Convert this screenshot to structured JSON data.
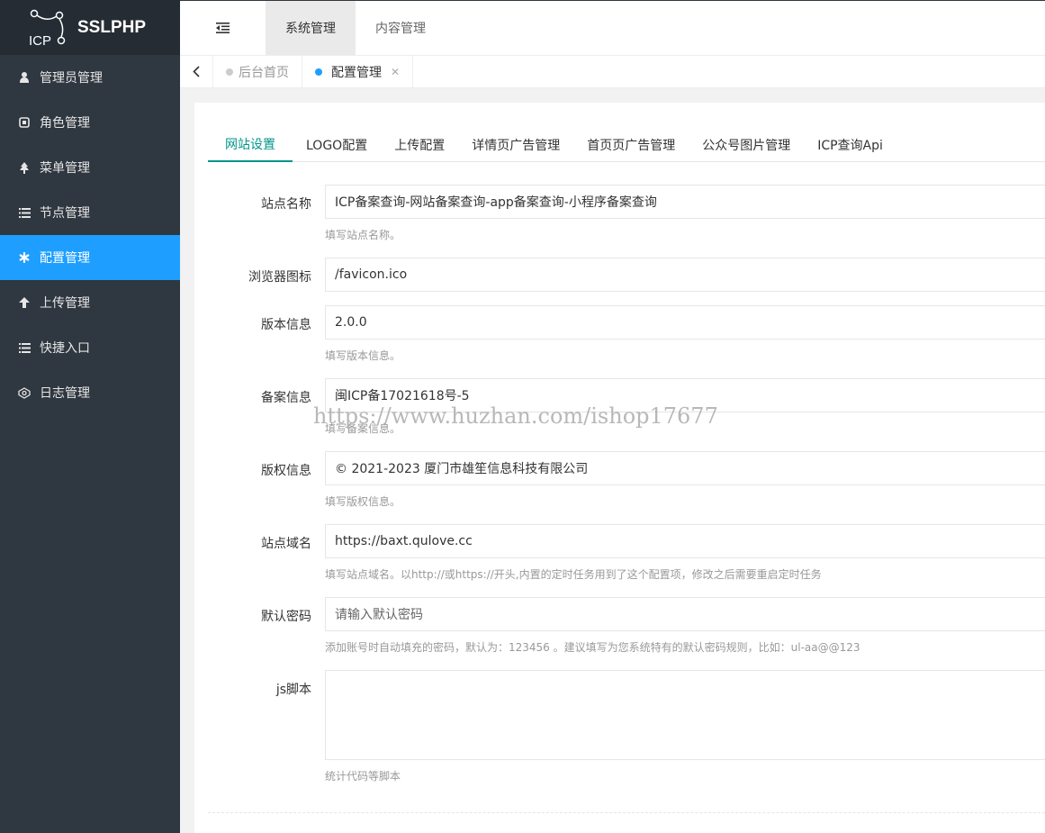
{
  "app": {
    "logo_mark": "ICP",
    "logo_text": "SSLPHP"
  },
  "sidebar": {
    "items": [
      {
        "label": "管理员管理",
        "icon": "user-icon"
      },
      {
        "label": "角色管理",
        "icon": "role-icon"
      },
      {
        "label": "菜单管理",
        "icon": "tree-icon"
      },
      {
        "label": "节点管理",
        "icon": "list-icon"
      },
      {
        "label": "配置管理",
        "icon": "gear-icon",
        "active": true
      },
      {
        "label": "上传管理",
        "icon": "arrow-up-icon"
      },
      {
        "label": "快捷入口",
        "icon": "list-icon"
      },
      {
        "label": "日志管理",
        "icon": "log-icon"
      }
    ]
  },
  "header": {
    "tabs": [
      {
        "label": "系统管理",
        "active": true
      },
      {
        "label": "内容管理"
      }
    ]
  },
  "tabbar": {
    "tabs": [
      {
        "label": "后台首页"
      },
      {
        "label": "配置管理",
        "active": true
      }
    ]
  },
  "settings_tabs": [
    "网站设置",
    "LOGO配置",
    "上传配置",
    "详情页广告管理",
    "首页页广告管理",
    "公众号图片管理",
    "ICP查询Api"
  ],
  "form": {
    "site_name": {
      "label": "站点名称",
      "value": "ICP备案查询-网站备案查询-app备案查询-小程序备案查询",
      "help": "填写站点名称。"
    },
    "favicon": {
      "label": "浏览器图标",
      "value": "/favicon.ico"
    },
    "version": {
      "label": "版本信息",
      "value": "2.0.0",
      "help": "填写版本信息。"
    },
    "beian": {
      "label": "备案信息",
      "value": "闽ICP备17021618号-5",
      "help": "填写备案信息。"
    },
    "copyright": {
      "label": "版权信息",
      "value": "© 2021-2023 厦门市雄笙信息科技有限公司",
      "help": "填写版权信息。"
    },
    "domain": {
      "label": "站点域名",
      "value": "https://baxt.qulove.cc",
      "help": "填写站点域名。以http://或https://开头,内置的定时任务用到了这个配置项，修改之后需要重启定时任务"
    },
    "default_password": {
      "label": "默认密码",
      "placeholder": "请输入默认密码",
      "help": "添加账号时自动填充的密码，默认为：123456 。建议填写为您系统特有的默认密码规则，比如：ul-aa@@123"
    },
    "js_script": {
      "label": "js脚本",
      "help": "统计代码等脚本"
    }
  },
  "watermark": "https://www.huzhan.com/ishop17677",
  "colors": {
    "sidebar_bg": "#2f3740",
    "active_blue": "#1e9fff",
    "tab_green": "#009688"
  }
}
